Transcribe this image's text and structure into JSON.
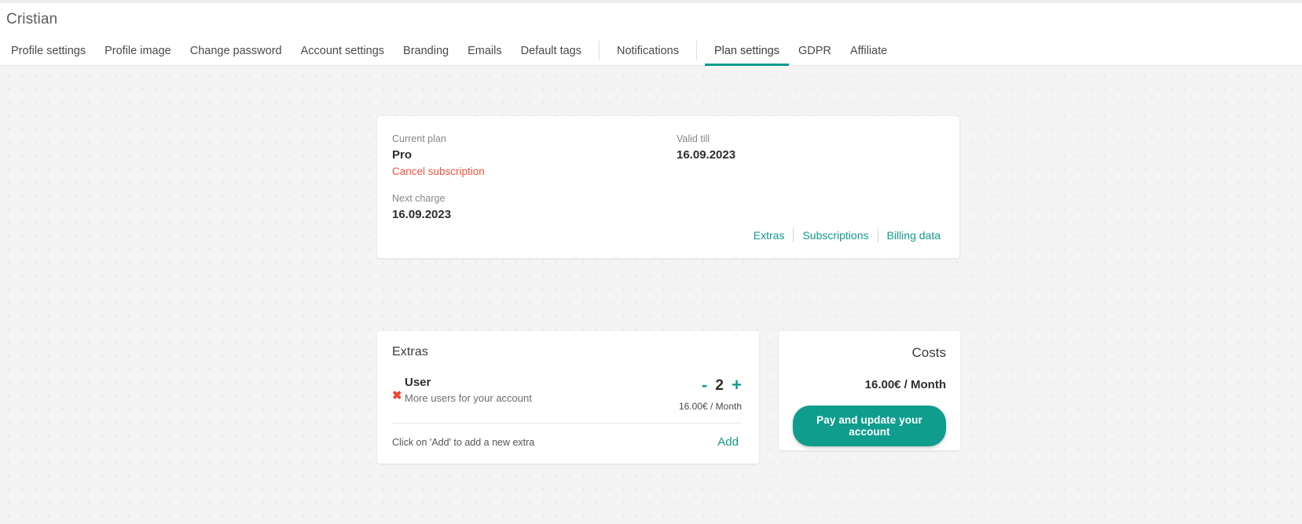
{
  "header": {
    "title": "Cristian"
  },
  "tabs": [
    {
      "label": "Profile settings",
      "active": false
    },
    {
      "label": "Profile image",
      "active": false
    },
    {
      "label": "Change password",
      "active": false
    },
    {
      "label": "Account settings",
      "active": false
    },
    {
      "label": "Branding",
      "active": false
    },
    {
      "label": "Emails",
      "active": false
    },
    {
      "label": "Default tags",
      "active": false
    },
    {
      "label": "Notifications",
      "active": false
    },
    {
      "label": "Plan settings",
      "active": true
    },
    {
      "label": "GDPR",
      "active": false
    },
    {
      "label": "Affiliate",
      "active": false
    }
  ],
  "plan_card": {
    "current_plan_label": "Current plan",
    "current_plan_value": "Pro",
    "cancel_link": "Cancel subscription",
    "next_charge_label": "Next charge",
    "next_charge_value": "16.09.2023",
    "valid_till_label": "Valid till",
    "valid_till_value": "16.09.2023",
    "actions": [
      {
        "label": "Extras"
      },
      {
        "label": "Subscriptions"
      },
      {
        "label": "Billing data"
      }
    ]
  },
  "extras_card": {
    "title": "Extras",
    "items": [
      {
        "remove_icon": "close-x-icon",
        "name": "User",
        "description": "More users for your account",
        "decrement_label": "-",
        "quantity": "2",
        "increment_label": "+",
        "price": "16.00€ / Month"
      }
    ],
    "hint": "Click on 'Add' to add a new extra",
    "add_label": "Add"
  },
  "costs_card": {
    "title": "Costs",
    "amount": "16.00€ / Month",
    "pay_button": "Pay and update your account"
  },
  "colors": {
    "accent": "#0d9c8c",
    "link": "#119b8c",
    "danger": "#f4543c",
    "remove": "#ef4434",
    "background": "#f4f4f4"
  }
}
